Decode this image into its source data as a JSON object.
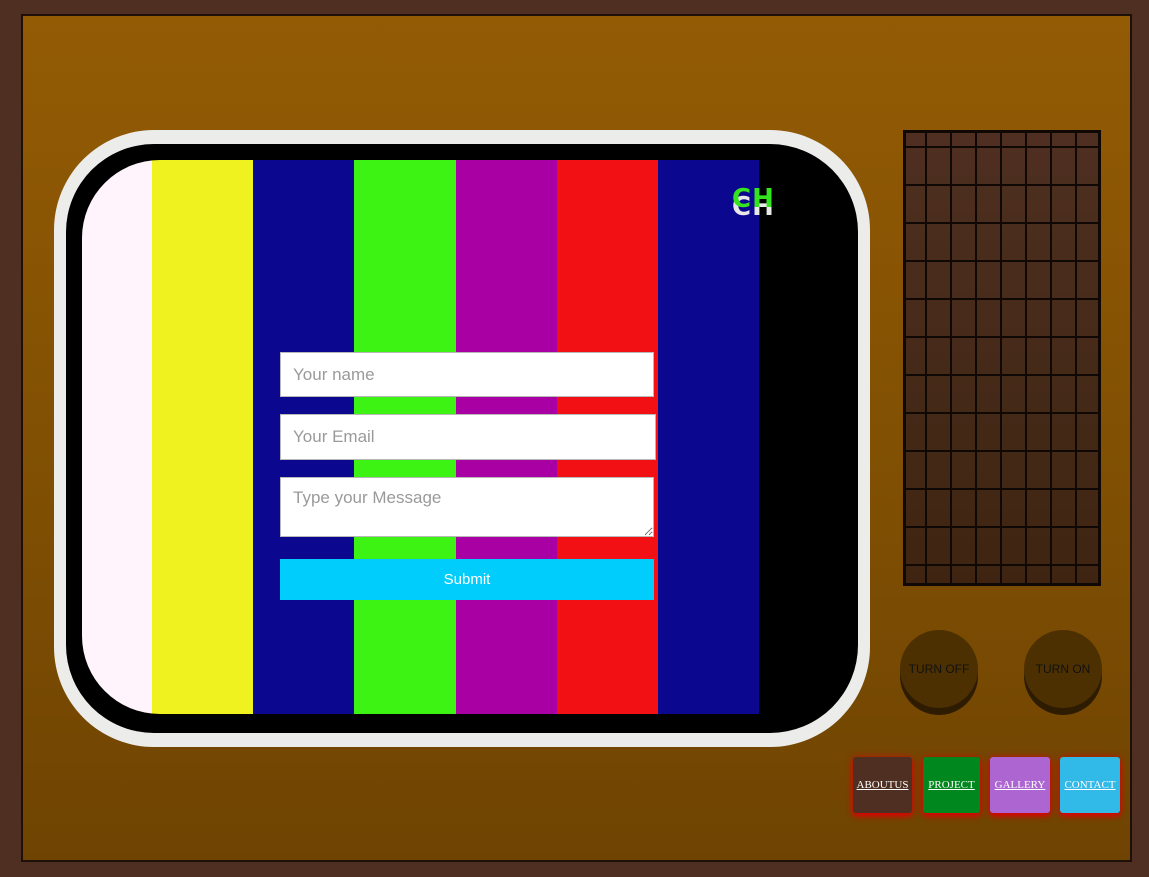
{
  "channel": {
    "label": "CH"
  },
  "colors": {
    "bars": [
      "#fff3fc",
      "#eff21e",
      "#0b078e",
      "#3cf314",
      "#a900a3",
      "#f31014",
      "#0b078e"
    ],
    "submit": "#00cdfc",
    "nav_aboutus": "#4e2f21",
    "nav_project": "#00871e",
    "nav_gallery": "#ad65d1",
    "nav_contact": "#31b9e7"
  },
  "form": {
    "name_placeholder": "Your name",
    "email_placeholder": "Your Email",
    "message_placeholder": "Type your Message",
    "submit_label": "Submit"
  },
  "controls": {
    "turn_off_label": "TURN OFF",
    "turn_on_label": "TURN ON"
  },
  "nav": {
    "aboutus": "ABOUTUS",
    "project": "PROJECT",
    "gallery": "GALLERY",
    "contact": "CONTACT"
  }
}
